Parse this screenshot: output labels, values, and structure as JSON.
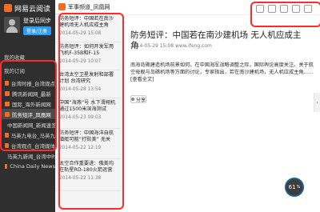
{
  "app": {
    "title": "网易云阅读"
  },
  "sidebar": {
    "account": {
      "name": "登录后同步",
      "action_label": "登录/注册"
    },
    "sections": {
      "favorites_label": "我的收藏",
      "subscriptions_label": "我的订阅"
    },
    "subscriptions": [
      {
        "label": "台湾时报_台湾观点"
      },
      {
        "label": "腾讯新闻网_最新"
      },
      {
        "label": "国际_海外新闻网"
      },
      {
        "label": "防务短评_凤凰网"
      },
      {
        "label": "中国新闻网_新闻速览"
      },
      {
        "label": "马英九电台_马英九"
      },
      {
        "label": "台湾观点_台湾媒体"
      },
      {
        "label": "马英九新闻_台湾中时"
      },
      {
        "label": "China Daily News"
      }
    ],
    "selected_index": 3
  },
  "list": {
    "header_title": "军事频道_凤凰网",
    "items": [
      {
        "title": "防务短评：中国若在南沙建机场无人机应成主角",
        "date": "2014-05-29 15:08"
      },
      {
        "title": "防务短评：如何开发军用飞机F-35B和F-15",
        "date": "2014-05-29 10:07"
      },
      {
        "title": "台湾太空卫星发射和部署计划 台湾研究",
        "date": "2014-05-28 13:54"
      },
      {
        "title": "中国“海燕”号 水下滑翔机通过1500米深海测试",
        "date": "2014-05-23 09:03"
      },
      {
        "title": "防务短评：中国海洋自航潜艇可能“打败美” 无关",
        "date": "2014-05-22 12:19"
      },
      {
        "title": "太空合作重要进：俄美均在轨星RD-180火箭运营",
        "date": "2014-05-22 11:38"
      }
    ]
  },
  "article": {
    "title": "防务短评：中国若在南沙建机场 无人机应成主角",
    "meta": "2014-05-29 15:08   www.ifeng.com",
    "body": "南海岛礁建造机场前景如何。在中国海军战略调整之际，国际舆论高度关注。关于航空母舰与岛礁机场等方面的讨论，专家指出，若在南沙建机场，无人机应成主角……[查看全文]",
    "share_label": "分享"
  },
  "toolbar": {
    "tool_icons": [
      "back-icon",
      "refresh-icon",
      "settings-icon",
      "minimize-icon",
      "close-icon"
    ]
  },
  "badge": {
    "value": "61",
    "unit": "%"
  },
  "colors": {
    "accent": "#f46b22",
    "annotation": "#ff2b2b"
  }
}
